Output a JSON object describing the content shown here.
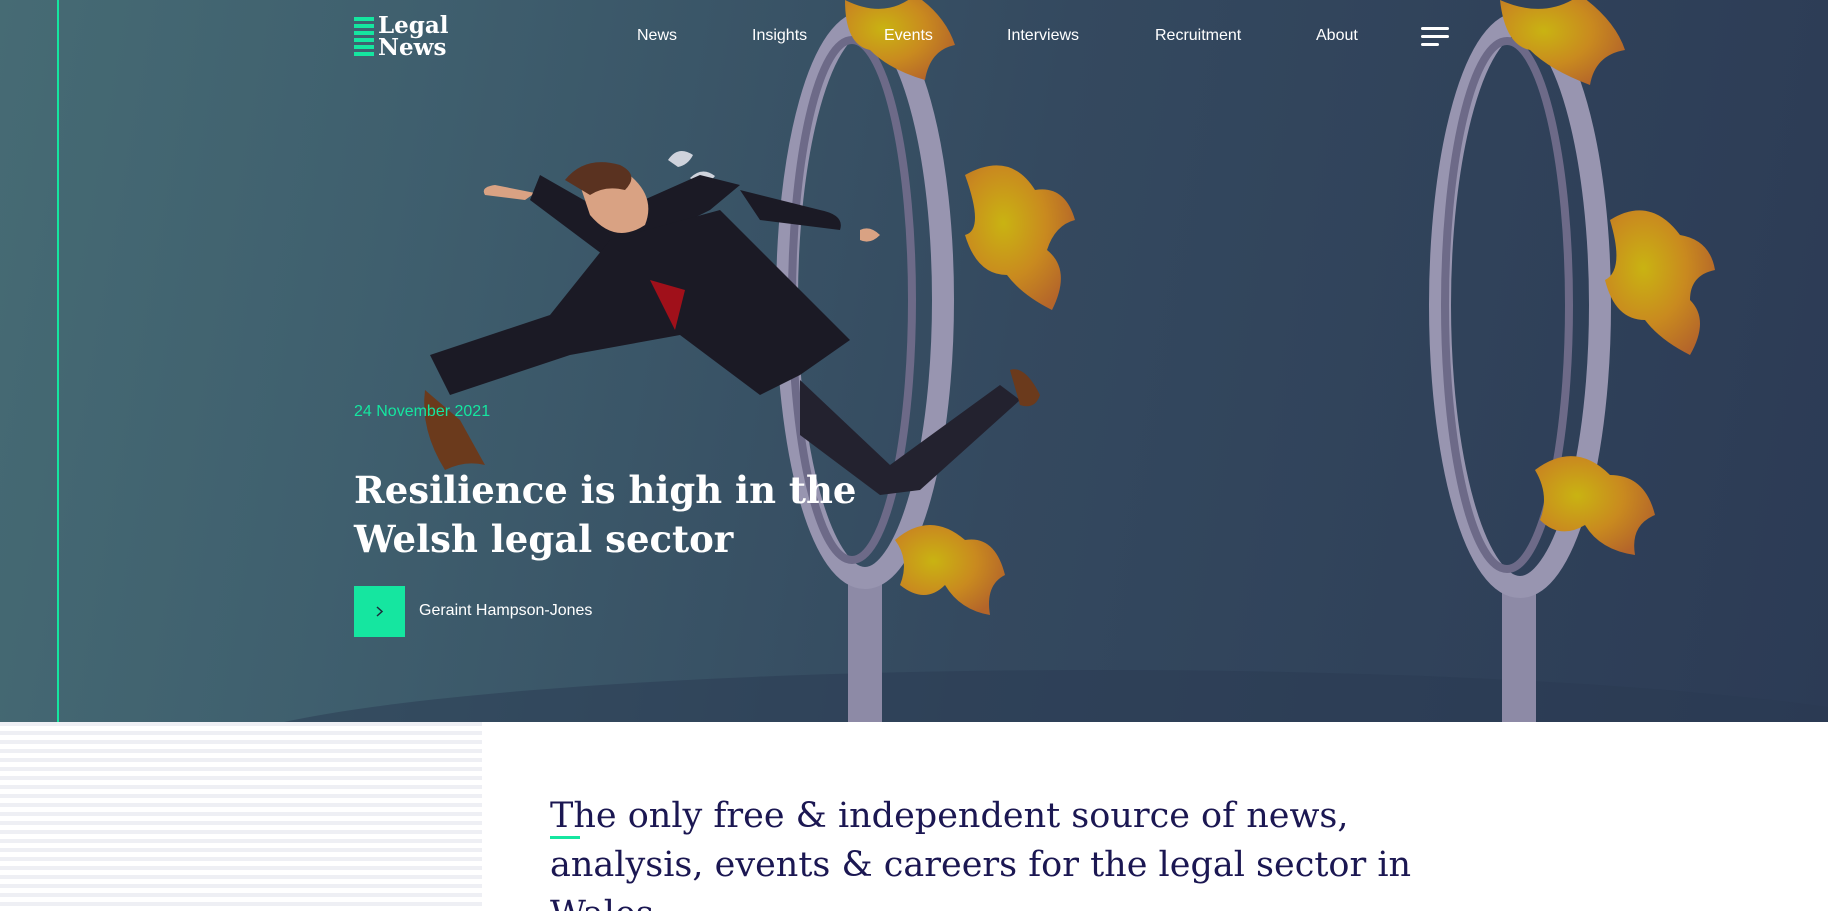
{
  "site": {
    "logo_line1": "Legal",
    "logo_line2": "News"
  },
  "nav": {
    "items": [
      "News",
      "Insights",
      "Events",
      "Interviews",
      "Recruitment",
      "About"
    ],
    "menu_icon": "hamburger-icon"
  },
  "hero": {
    "date": "24 November 2021",
    "title": "Resilience is high in the Welsh legal sector",
    "author": "Geraint Hampson-Jones",
    "author_icon": "chevron-right-icon"
  },
  "intro": {
    "tagline": "The only free & independent source of news, analysis, events & careers for the legal sector in Wales."
  },
  "colors": {
    "accent": "#15e6a0",
    "hero_bg": "#34495f",
    "tagline_text": "#1b1752"
  }
}
